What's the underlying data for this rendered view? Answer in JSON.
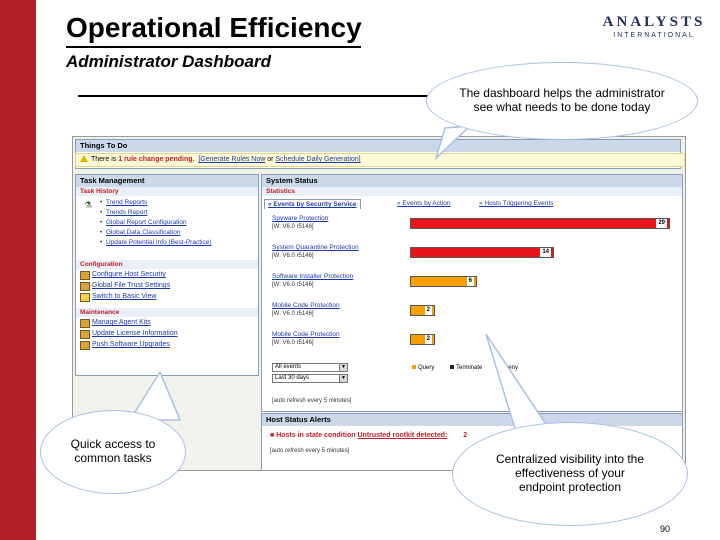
{
  "slide": {
    "title": "Operational Efficiency",
    "subtitle": "Administrator Dashboard",
    "logo_top": "ANALYSTS",
    "logo_bottom": "INTERNATIONAL",
    "page_number": "90",
    "accent_color": "#b21f27"
  },
  "callouts": {
    "top_right": "The dashboard helps the administrator see what needs to be done today",
    "bottom_left": "Quick access to common tasks",
    "bottom_center": "Centralized visibility into the effectiveness of your endpoint protection"
  },
  "dashboard": {
    "things_to_do": {
      "header": "Things To Do",
      "alert_prefix": "There is ",
      "alert_count": "1 rule change pending.",
      "link_generate": "[Generate Rules Now",
      "link_or": " or ",
      "link_schedule": "Schedule Daily Generation]"
    },
    "task_management": {
      "header": "Task Management",
      "task_history_label": "Task History",
      "task_history_items": [
        "Trend Reports",
        "Trends Report",
        "Global Report Configuration",
        "Global Data Classification",
        "Update Potential Info (Best-Practice)"
      ],
      "configuration_label": "Configuration",
      "configuration_items": [
        "Configure Host Security",
        "Global File Trust Settings",
        "Switch to Basic View"
      ],
      "maintenance_label": "Maintenance",
      "maintenance_items": [
        "Manage Agent Kits",
        "Update License Information",
        "Push Software Upgrades"
      ]
    },
    "system_status": {
      "header": "System Status",
      "statistics_label": "Statistics",
      "tabs": [
        "« Events by Security Service",
        "» Events by Action",
        "» Hosts Triggering Events"
      ],
      "services": [
        {
          "name": "Spyware Protection",
          "version": "[W: V6.0 r5146]",
          "value": "29",
          "fraction": 1.0,
          "color": "#e8141a"
        },
        {
          "name": "System Quarantine Protection",
          "version": "[W: V6.0 r5146]",
          "value": "14",
          "fraction": 0.55,
          "color": "#e8141a"
        },
        {
          "name": "Software Installer Protection",
          "version": "[W: V6.0 r5146]",
          "value": "6",
          "fraction": 0.25,
          "color": "#f5a000"
        },
        {
          "name": "Mobile Code Protection",
          "version": "[W: V6.0 r5146]",
          "value": "2",
          "fraction": 0.09,
          "color": "#f5a000"
        },
        {
          "name": "Mobile Code Protection",
          "version": "[W: V6.0 r5146]",
          "value": "2",
          "fraction": 0.09,
          "color": "#f5a000"
        }
      ],
      "filter_events": "All events",
      "filter_days": "Last 30 days",
      "legend": [
        {
          "label": "Query",
          "color": "#f5a000"
        },
        {
          "label": "Terminate",
          "color": "#222222"
        },
        {
          "label": "Deny",
          "color": "#e8141a"
        }
      ],
      "auto_refresh": "[auto refresh every 5 minutes]"
    },
    "host_status_alerts": {
      "header": "Host Status Alerts",
      "alert_label": "Hosts in state condition",
      "alert_link": "Untrusted rootkit detected:",
      "alert_count": "2",
      "auto_refresh": "[auto refresh every 5 minutes]"
    }
  }
}
